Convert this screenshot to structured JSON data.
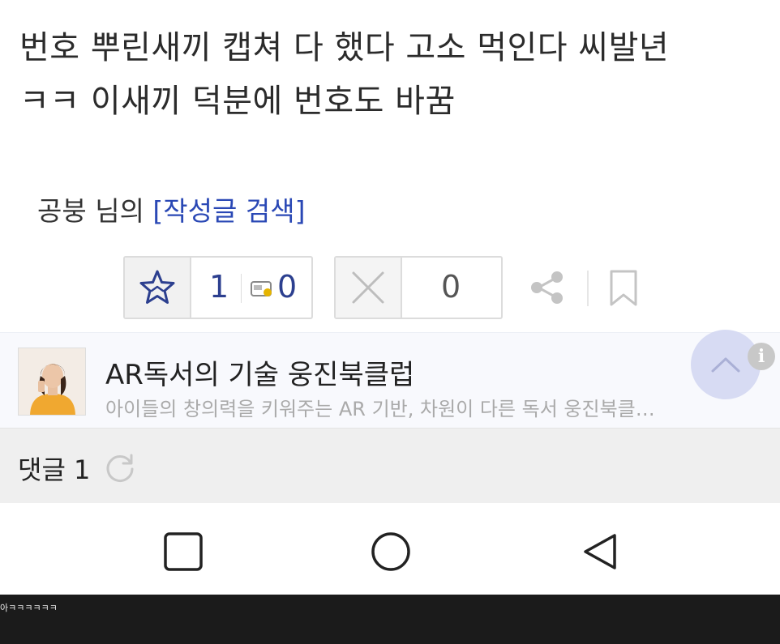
{
  "post": {
    "line1": "번호 뿌린새끼 캡쳐 다 했다 고소 먹인다 씨발년",
    "line2": "ㅋㅋ 이새끼 덕분에 번호도 바꿈",
    "author": "공붕 님의 ",
    "search_link": "[작성글 검색]"
  },
  "votes": {
    "up_count": "1",
    "gift_count": "0",
    "down_count": "0"
  },
  "ad": {
    "title": "AR독서의 기술 웅진북클럽",
    "description": "아이들의 창의력을 키워주는 AR 기반, 차원이 다른 독서 웅진북클…"
  },
  "comments": {
    "label": "댓글 1"
  },
  "caption": {
    "text": "아ㅋㅋㅋㅋㅋㅋ"
  },
  "colors": {
    "accent": "#2a48b5",
    "vote_text": "#2c3f8f"
  }
}
